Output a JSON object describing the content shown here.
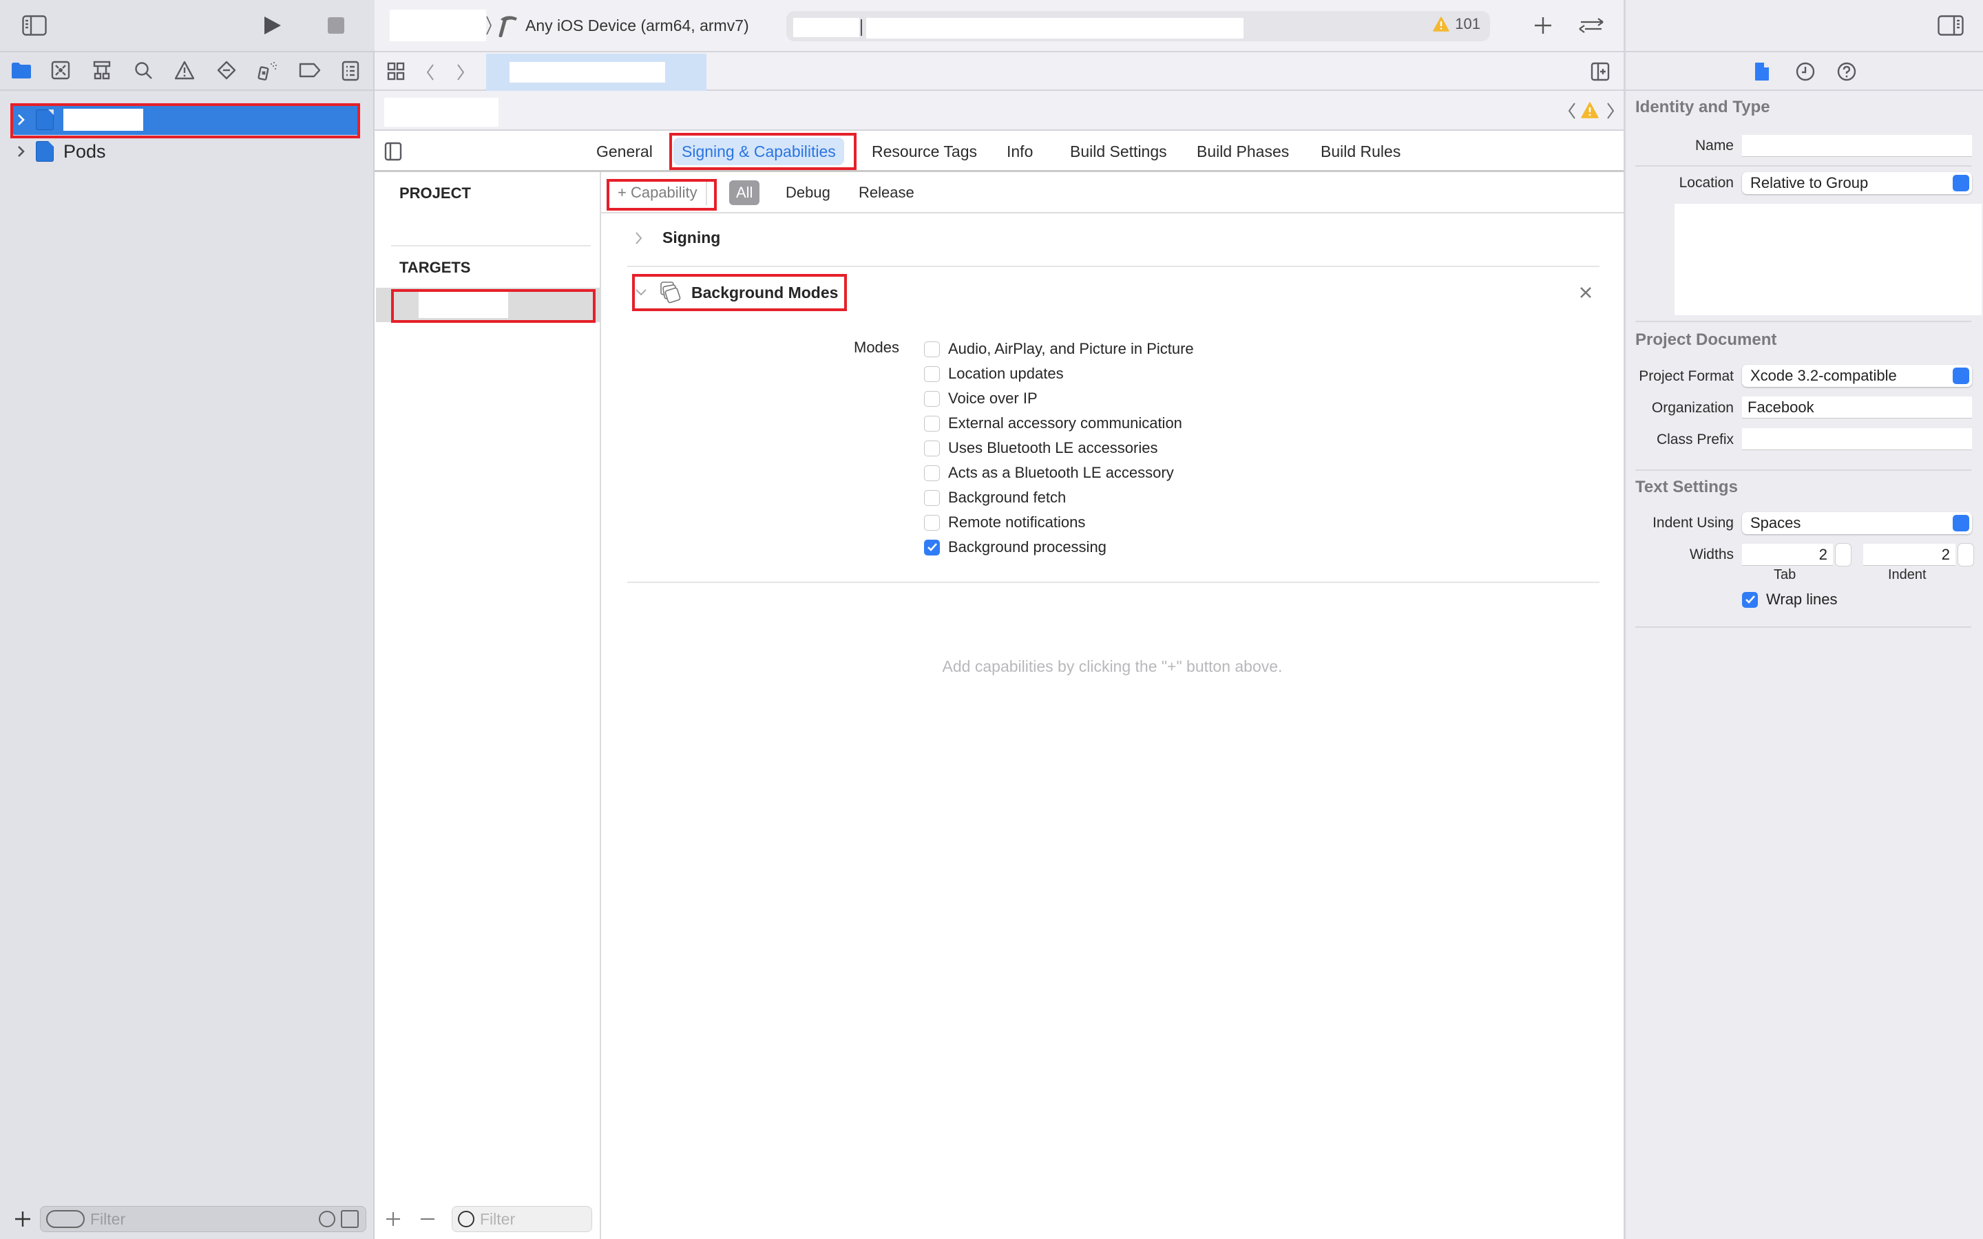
{
  "toolbar": {
    "run_button": "run",
    "stop_button": "stop",
    "destination": "Any iOS Device (arm64, armv7)",
    "warning_count": "101",
    "add_button": "+",
    "code_review_button": "code-review"
  },
  "navigator": {
    "tabs": [
      "project-navigator",
      "source-control-navigator",
      "symbol-navigator",
      "find-navigator",
      "issue-navigator",
      "test-navigator",
      "debug-navigator",
      "breakpoint-navigator",
      "report-navigator"
    ],
    "tree": [
      {
        "label": "",
        "selected": true,
        "redacted": true
      },
      {
        "label": "Pods",
        "selected": false
      }
    ],
    "filter_placeholder": "Filter"
  },
  "editor": {
    "tabs": [
      {
        "label": "General",
        "active": false
      },
      {
        "label": "Signing & Capabilities",
        "active": true
      },
      {
        "label": "Resource Tags",
        "active": false
      },
      {
        "label": "Info",
        "active": false
      },
      {
        "label": "Build Settings",
        "active": false
      },
      {
        "label": "Build Phases",
        "active": false
      },
      {
        "label": "Build Rules",
        "active": false
      }
    ],
    "project_heading": "PROJECT",
    "targets_heading": "TARGETS",
    "targets_filter_placeholder": "Filter",
    "capability_button": "+ Capability",
    "config_filters": [
      {
        "label": "All",
        "selected": true
      },
      {
        "label": "Debug",
        "selected": false
      },
      {
        "label": "Release",
        "selected": false
      }
    ],
    "sections": {
      "signing": {
        "title": "Signing",
        "expanded": false
      },
      "background_modes": {
        "title": "Background Modes",
        "expanded": true,
        "modes_label": "Modes",
        "modes": [
          {
            "label": "Audio, AirPlay, and Picture in Picture",
            "checked": false
          },
          {
            "label": "Location updates",
            "checked": false
          },
          {
            "label": "Voice over IP",
            "checked": false
          },
          {
            "label": "External accessory communication",
            "checked": false
          },
          {
            "label": "Uses Bluetooth LE accessories",
            "checked": false
          },
          {
            "label": "Acts as a Bluetooth LE accessory",
            "checked": false
          },
          {
            "label": "Background fetch",
            "checked": false
          },
          {
            "label": "Remote notifications",
            "checked": false
          },
          {
            "label": "Background processing",
            "checked": true
          }
        ]
      }
    },
    "hint": "Add capabilities by clicking the \"+\" button above."
  },
  "inspector": {
    "identity": {
      "heading": "Identity and Type",
      "name_label": "Name",
      "name_value": "",
      "location_label": "Location",
      "location_value": "Relative to Group"
    },
    "project_document": {
      "heading": "Project Document",
      "format_label": "Project Format",
      "format_value": "Xcode 3.2-compatible",
      "org_label": "Organization",
      "org_value": "Facebook",
      "prefix_label": "Class Prefix",
      "prefix_value": ""
    },
    "text_settings": {
      "heading": "Text Settings",
      "indent_using_label": "Indent Using",
      "indent_using_value": "Spaces",
      "widths_label": "Widths",
      "tab_value": "2",
      "tab_label": "Tab",
      "indent_value": "2",
      "indent_label": "Indent",
      "wrap_lines_label": "Wrap lines",
      "wrap_lines": true
    }
  },
  "colors": {
    "accent": "#2f7cf6",
    "selection": "#3380e0",
    "annotation": "#e5202a",
    "warning": "#f5b82e"
  }
}
